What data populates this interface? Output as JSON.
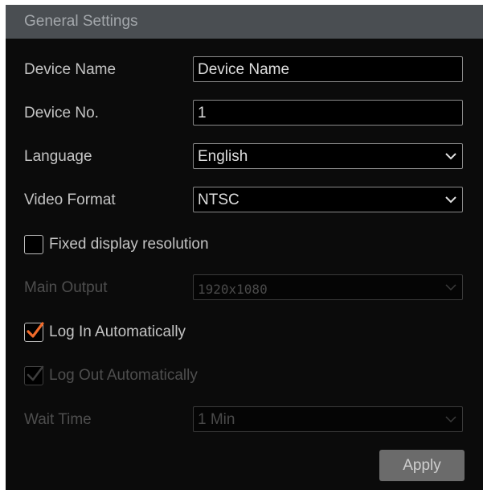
{
  "header": {
    "title": "General Settings"
  },
  "form": {
    "device_name": {
      "label": "Device Name",
      "value": "Device Name"
    },
    "device_no": {
      "label": "Device No.",
      "value": "1"
    },
    "language": {
      "label": "Language",
      "value": "English",
      "icon": "chevron-down-icon"
    },
    "video_format": {
      "label": "Video Format",
      "value": "NTSC",
      "icon": "chevron-down-icon"
    },
    "fixed_display_resolution": {
      "label": "Fixed display resolution",
      "checked": false
    },
    "main_output": {
      "label": "Main Output",
      "value": "1920x1080",
      "disabled": true
    },
    "log_in_automatically": {
      "label": "Log In Automatically",
      "checked": true,
      "check_color": "#f06a2a"
    },
    "log_out_automatically": {
      "label": "Log Out Automatically",
      "checked": true,
      "disabled": true
    },
    "wait_time": {
      "label": "Wait Time",
      "value": "1 Min",
      "disabled": true
    }
  },
  "actions": {
    "apply_label": "Apply"
  },
  "colors": {
    "panel_background": "#0b0b0b",
    "header_background": "#4a4e52",
    "text": "#c4c4c4",
    "disabled_text": "#4e4e4e",
    "button_background": "#6b6b6b"
  }
}
